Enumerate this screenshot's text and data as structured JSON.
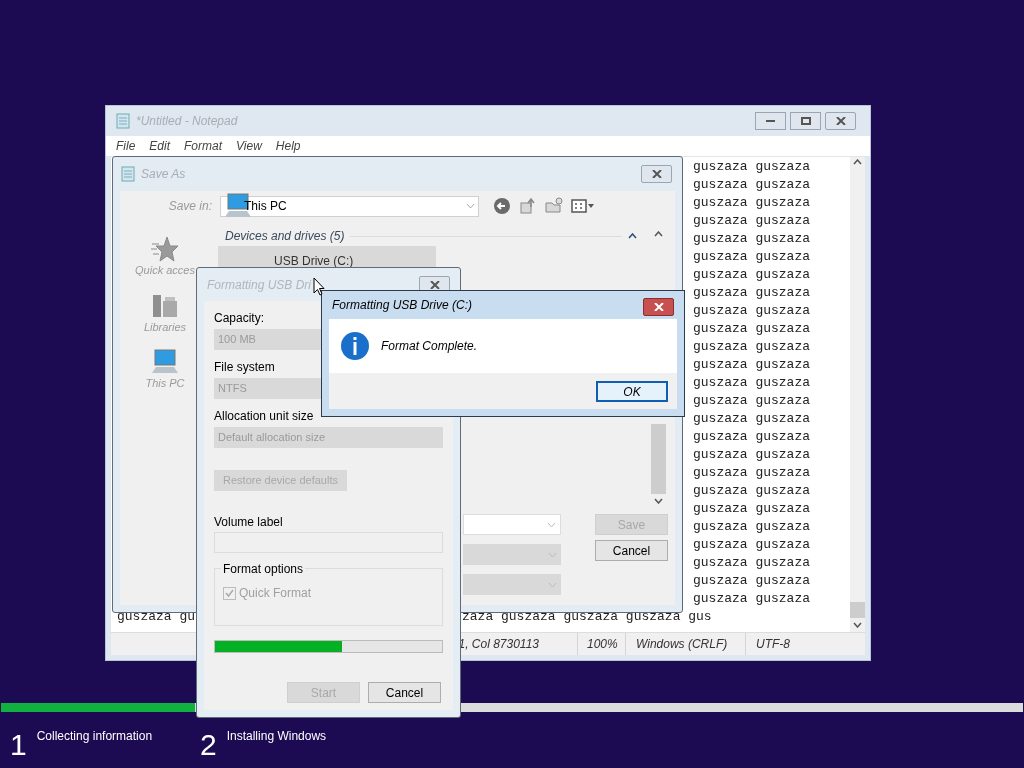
{
  "setup": {
    "progress": {
      "level": 0.19
    },
    "steps": [
      {
        "number": "1",
        "label": "Collecting information"
      },
      {
        "number": "2",
        "label": "Installing Windows"
      }
    ]
  },
  "notepad": {
    "title": "*Untitled - Notepad",
    "menu": [
      "File",
      "Edit",
      "Format",
      "View",
      "Help"
    ],
    "lines": [
      "guszaza guszaza",
      "guszaza guszaza",
      "guszaza guszaza",
      "guszaza guszaza",
      "guszaza guszaza",
      "guszaza guszaza",
      "guszaza guszaza",
      "guszaza guszaza",
      "guszaza guszaza",
      "guszaza guszaza",
      "guszaza guszaza",
      "guszaza guszaza",
      "guszaza guszaza",
      "guszaza guszaza",
      "guszaza guszaza",
      "guszaza guszaza",
      "guszaza guszaza",
      "guszaza guszaza",
      "guszaza guszaza",
      "guszaza guszaza",
      "guszaza guszaza",
      "guszaza guszaza",
      "guszaza guszaza",
      "guszaza guszaza",
      "guszaza guszaza"
    ],
    "last_line_parts": [
      "guszaza gu",
      "zaza guszaza guszaza guszaza gus"
    ],
    "status": [
      "1, Col 8730113",
      "100%",
      "Windows (CRLF)",
      "UTF-8"
    ]
  },
  "save_as": {
    "title": "Save As",
    "save_in_label": "Save in:",
    "location": "This PC",
    "places": [
      {
        "kind": "star",
        "label": "Quick acces"
      },
      {
        "kind": "library",
        "label": "Libraries"
      },
      {
        "kind": "computer",
        "label": "This PC"
      }
    ],
    "group_header": "Devices and drives (5)",
    "drive": "USB Drive (C:)",
    "buttons": [
      {
        "label": "Save",
        "disabled": true
      },
      {
        "label": "Cancel",
        "disabled": false
      }
    ]
  },
  "format_dialog": {
    "title": "Formatting USB Dri",
    "fields": [
      {
        "label": "Capacity:",
        "value": "100 MB",
        "disabled": true
      },
      {
        "label": "File system",
        "value": "NTFS",
        "disabled": true
      },
      {
        "label": "Allocation unit size",
        "value": "Default allocation size",
        "disabled": true
      }
    ],
    "restore_button": {
      "label": "Restore device defaults",
      "disabled": true
    },
    "volume_label": "Volume label",
    "options_label": "Format options",
    "quick_format": {
      "label": "Quick Format",
      "checked": true,
      "disabled": true
    },
    "progress": {
      "level": 0.56
    },
    "buttons": [
      {
        "label": "Start",
        "disabled": true
      },
      {
        "label": "Cancel",
        "disabled": false
      }
    ]
  },
  "message_box": {
    "title": "Formatting USB Drive (C:)",
    "message": "Format Complete.",
    "button": "OK"
  }
}
